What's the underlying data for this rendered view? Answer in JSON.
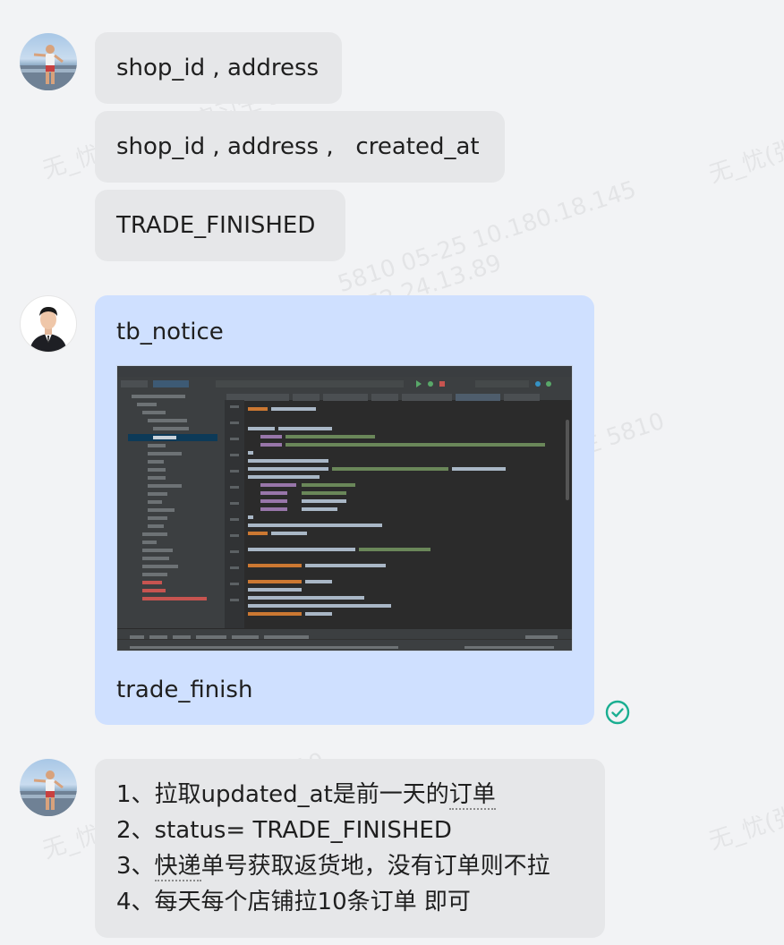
{
  "watermarks": {
    "w1": "无_忧(张茂凯)_实习生 5810",
    "w2": "5810 05-25 10.180.18.145",
    "w3": "172.24.13.89",
    "w4": "无_忧(张",
    "w5": "无_忧(张茂凯)_实习生 5810",
    "w6": "无_忧(张茂凯)_实习生 5810",
    "w7": "无_忧(张",
    "w8": "无_忧(张"
  },
  "messages": {
    "m1": "shop_id , address",
    "m2": "shop_id , address ,   created_at",
    "m3": "TRADE_FINISHED",
    "m4_title": "tb_notice",
    "m4_footer": "trade_finish",
    "m5": {
      "line1_prefix": "1、拉取updated_at是前一天的",
      "line1_link": "订单",
      "line2": "2、status= TRADE_FINISHED",
      "line3_prefix": "3、",
      "line3_link": "快递",
      "line3_suffix": "单号获取返货地，没有订单则不拉",
      "line4": "4、每天每个店铺拉10条订单 即可"
    }
  },
  "colors": {
    "bubble_grey": "#e6e7e9",
    "bubble_blue": "#cfe0ff",
    "read_check": "#1aae91",
    "background": "#f2f3f5"
  },
  "icons": {
    "read_status": "check-circle-icon"
  }
}
